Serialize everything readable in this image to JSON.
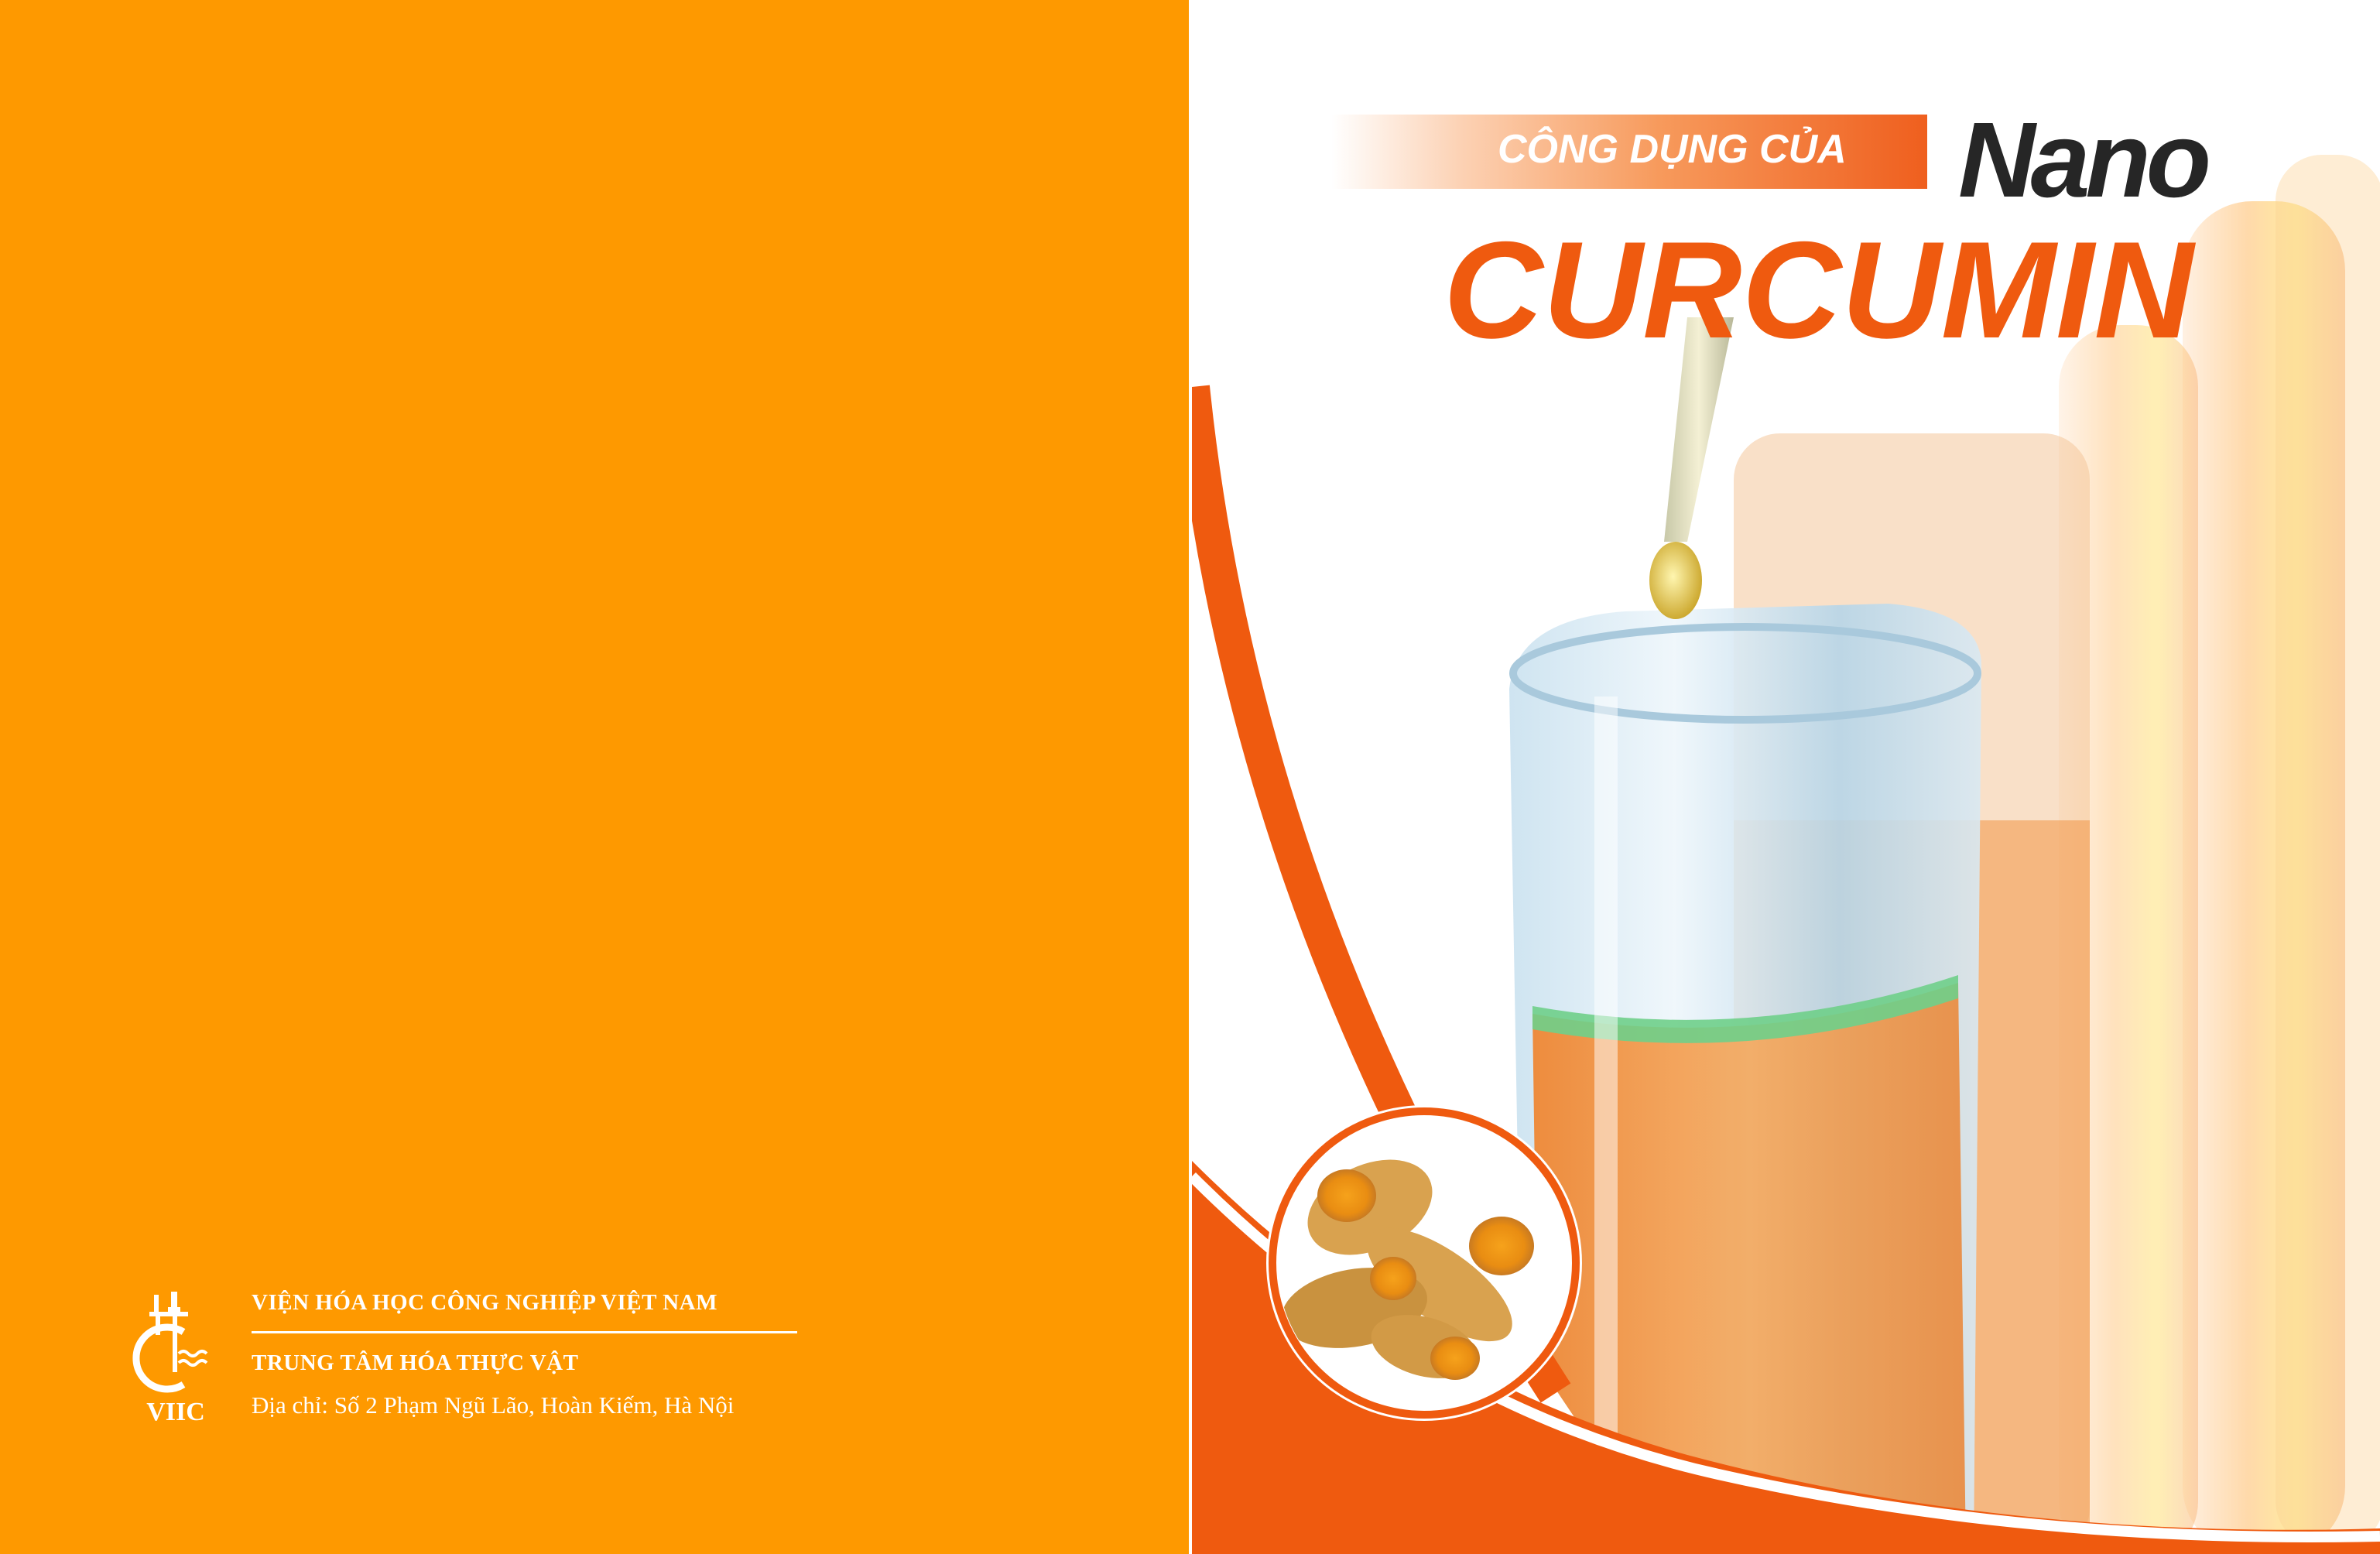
{
  "back_cover": {
    "logo_text": "VIIC",
    "organization": "VIỆN HÓA HỌC CÔNG NGHIỆP VIỆT NAM",
    "center": "TRUNG TÂM HÓA THỰC VẬT",
    "address": "Địa chỉ: Số 2 Phạm Ngũ Lão, Hoàn Kiếm, Hà Nội"
  },
  "front_cover": {
    "subtitle": "CÔNG DỤNG CỦA",
    "title_small": "Nano",
    "title_main": "CURCUMIN"
  },
  "colors": {
    "back_cover": "#FE9900",
    "front_orange": "#EF5A0F",
    "title_dark": "#262626",
    "turmeric": "#F0A020"
  },
  "icons": [
    "viic-logo-icon",
    "dropper-icon",
    "test-tube-icon",
    "turmeric-root-icon"
  ]
}
